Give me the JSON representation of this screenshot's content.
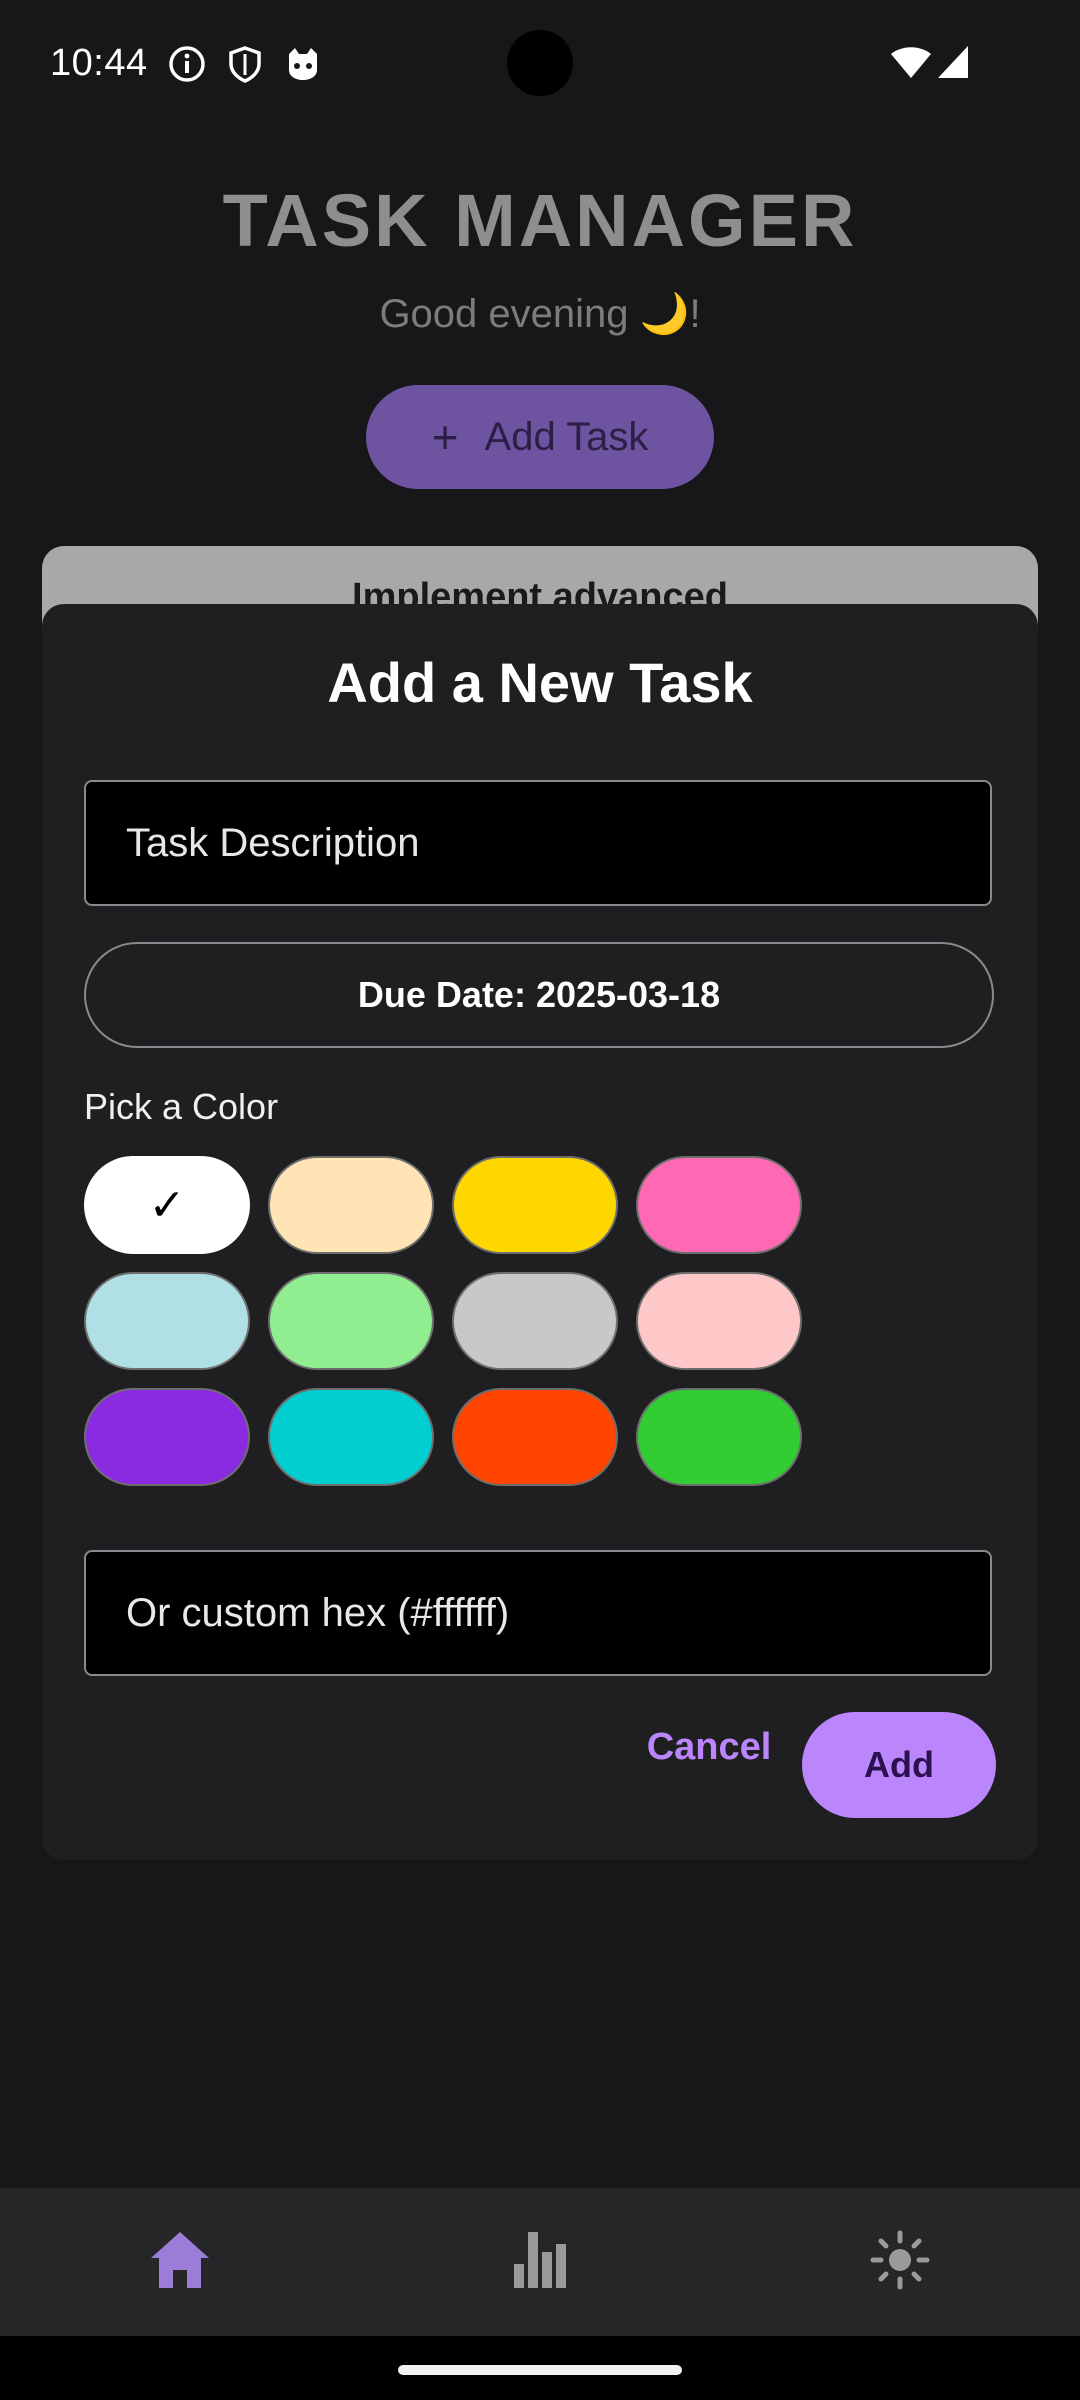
{
  "status_bar": {
    "time": "10:44",
    "left_icons": [
      "info-icon",
      "shield-icon",
      "cat-face-icon"
    ],
    "right_icons": [
      "wifi-icon",
      "cellular-signal-icon"
    ]
  },
  "header": {
    "title": "TASK MANAGER",
    "greeting": "Good evening 🌙!",
    "add_task_label": "Add Task"
  },
  "background_task": {
    "title": "Implement advanced"
  },
  "dialog": {
    "title": "Add a New Task",
    "description_placeholder": "Task Description",
    "due_date_label": "Due Date: 2025-03-18",
    "pick_color_label": "Pick a Color",
    "colors": [
      {
        "hex": "#ffffff",
        "selected": true,
        "mark": "✓"
      },
      {
        "hex": "#ffe4b5",
        "selected": false,
        "mark": ""
      },
      {
        "hex": "#ffd700",
        "selected": false,
        "mark": ""
      },
      {
        "hex": "#ff69b4",
        "selected": false,
        "mark": ""
      },
      {
        "hex": "#b0e0e6",
        "selected": false,
        "mark": ""
      },
      {
        "hex": "#90ee90",
        "selected": false,
        "mark": ""
      },
      {
        "hex": "#c8c8c8",
        "selected": false,
        "mark": ""
      },
      {
        "hex": "#ffc8c8",
        "selected": false,
        "mark": ""
      },
      {
        "hex": "#8a2be2",
        "selected": false,
        "mark": ""
      },
      {
        "hex": "#00ced1",
        "selected": false,
        "mark": ""
      },
      {
        "hex": "#ff4500",
        "selected": false,
        "mark": ""
      },
      {
        "hex": "#32cd32",
        "selected": false,
        "mark": ""
      }
    ],
    "custom_hex_placeholder": "Or custom hex (#ffffff)",
    "cancel_label": "Cancel",
    "add_label": "Add"
  },
  "bottom_nav": {
    "items": [
      {
        "icon": "home-icon",
        "active": true
      },
      {
        "icon": "bar-chart-icon",
        "active": false
      },
      {
        "icon": "brightness-icon",
        "active": false
      }
    ]
  },
  "theme": {
    "accent": "#bb86fc",
    "background": "#17171a",
    "dialog_background": "#1f1f21"
  }
}
